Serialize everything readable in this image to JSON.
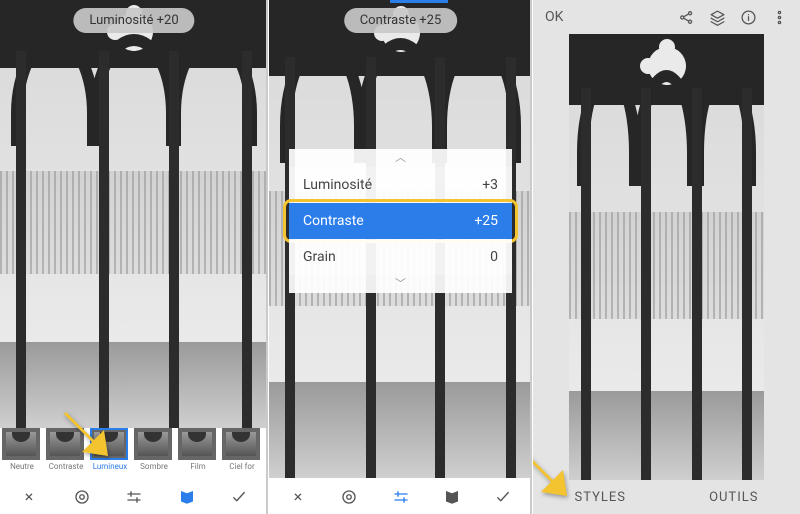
{
  "panelA": {
    "badge": "Luminosité +20",
    "presets": [
      {
        "label": "Neutre"
      },
      {
        "label": "Contraste"
      },
      {
        "label": "Lumineux",
        "selected": true
      },
      {
        "label": "Sombre"
      },
      {
        "label": "Film"
      },
      {
        "label": "Ciel for"
      }
    ],
    "toolbar": {
      "close": "×",
      "accept": "✓"
    }
  },
  "panelB": {
    "badge": "Contraste +25",
    "sliders": [
      {
        "name": "Luminosité",
        "value": "+3"
      },
      {
        "name": "Contraste",
        "value": "+25",
        "selected": true,
        "highlight": true
      },
      {
        "name": "Grain",
        "value": "0"
      }
    ],
    "toolbar": {
      "close": "×",
      "accept": "✓"
    }
  },
  "panelC": {
    "ok": "OK",
    "styles": "STYLES",
    "tools": "OUTILS"
  },
  "colors": {
    "accent": "#2b7de9",
    "arrow": "#f4c430"
  }
}
